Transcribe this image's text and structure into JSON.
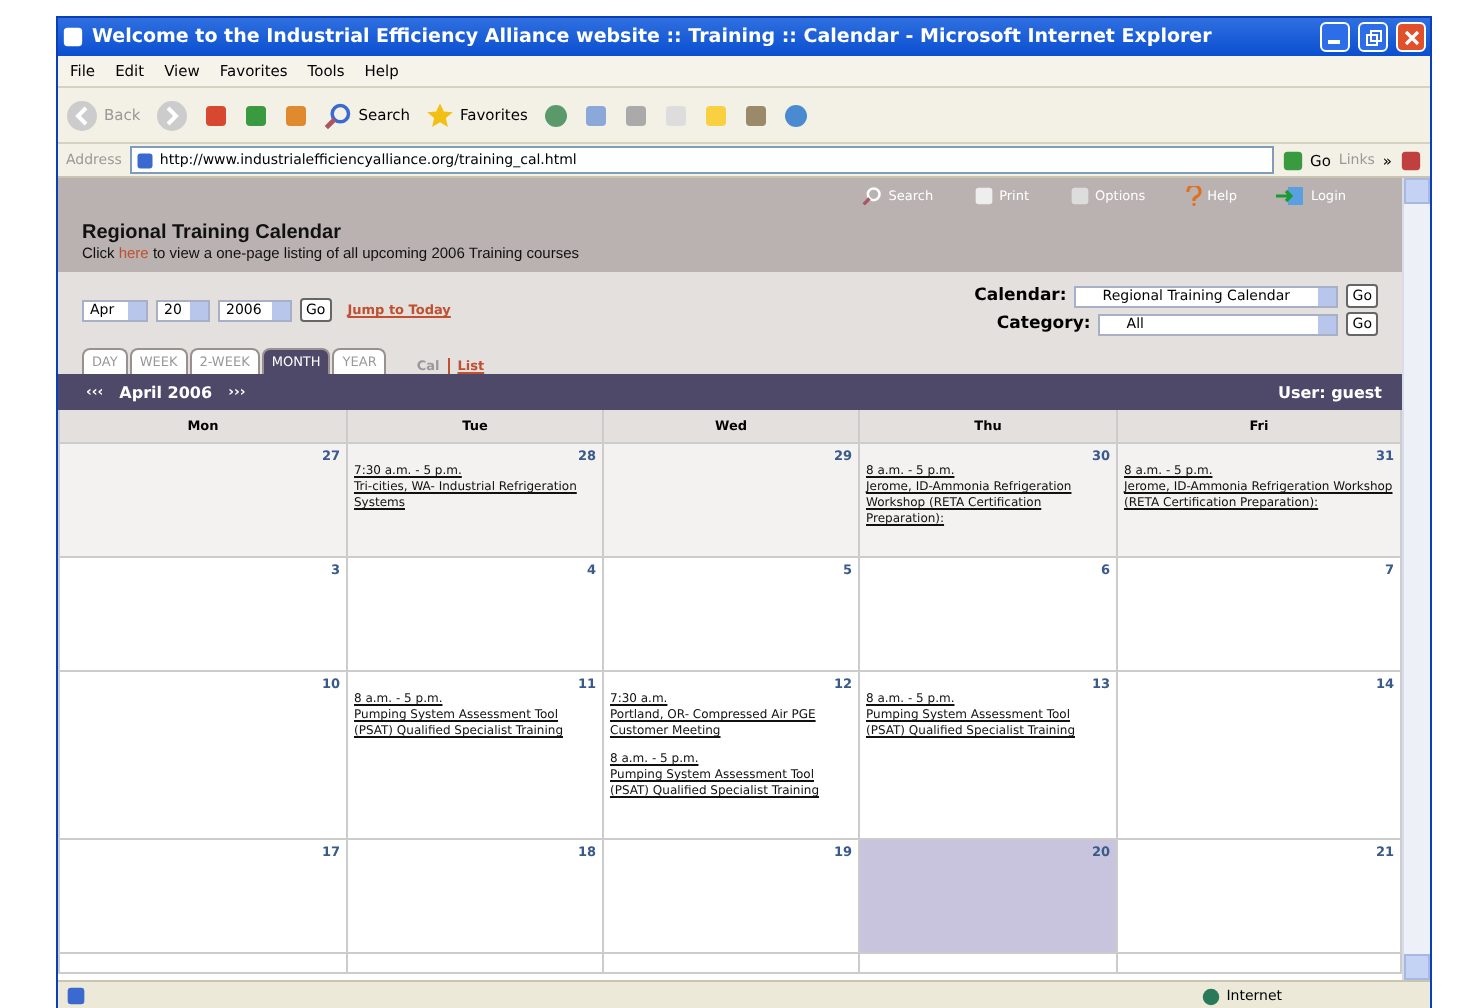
{
  "window": {
    "title": "Welcome to the Industrial Efficiency Alliance website :: Training :: Calendar - Microsoft Internet Explorer"
  },
  "menu": [
    "File",
    "Edit",
    "View",
    "Favorites",
    "Tools",
    "Help"
  ],
  "toolbar": {
    "back": "Back",
    "search": "Search",
    "favorites": "Favorites"
  },
  "address": {
    "label": "Address",
    "url": "http://www.industrialefficiencyalliance.org/training_cal.html",
    "go": "Go",
    "links": "Links",
    "more": "»"
  },
  "site_links": [
    {
      "kind": "search",
      "label": "Search"
    },
    {
      "kind": "print",
      "label": "Print"
    },
    {
      "kind": "options",
      "label": "Options"
    },
    {
      "kind": "help",
      "label": "Help"
    },
    {
      "kind": "login",
      "label": "Login"
    }
  ],
  "heading": {
    "title": "Regional Training Calendar",
    "before": "Click ",
    "link": "here",
    "after": " to view a one-page listing of all upcoming 2006 Training courses"
  },
  "date_picker": {
    "month": "Apr",
    "day": "20",
    "year": "2006",
    "go": "Go",
    "jump": "Jump to Today"
  },
  "filters": [
    {
      "label": "Calendar:",
      "value": "Regional Training Calendar",
      "go": "Go"
    },
    {
      "label": "Category:",
      "value": "All",
      "go": "Go"
    }
  ],
  "tabs": [
    {
      "label": "DAY",
      "selected": false
    },
    {
      "label": "WEEK",
      "selected": false
    },
    {
      "label": "2-WEEK",
      "selected": false
    },
    {
      "label": "MONTH",
      "selected": true
    },
    {
      "label": "YEAR",
      "selected": false
    }
  ],
  "views": [
    {
      "label": "Cal",
      "selected": false
    },
    {
      "label": "List",
      "selected": true
    }
  ],
  "month_bar": {
    "prev": "‹‹‹",
    "title": "April 2006",
    "next": "›››",
    "user": "User: guest"
  },
  "weekdays": [
    "Mon",
    "Tue",
    "Wed",
    "Thu",
    "Fri"
  ],
  "weeks": [
    [
      {
        "date": "27",
        "other_month": true,
        "today": false
      },
      {
        "date": "28",
        "other_month": true,
        "today": false,
        "events": [
          {
            "time": "7:30 a.m. - 5 p.m.",
            "title": "Tri-cities, WA- Industrial Refrigeration Systems"
          }
        ]
      },
      {
        "date": "29",
        "other_month": true,
        "today": false
      },
      {
        "date": "30",
        "other_month": true,
        "today": false,
        "events": [
          {
            "time": "8 a.m. - 5 p.m.",
            "title": "Jerome, ID-Ammonia Refrigeration Workshop (RETA Certification Preparation):"
          }
        ]
      },
      {
        "date": "31",
        "other_month": true,
        "today": false,
        "events": [
          {
            "time": "8 a.m. - 5 p.m.",
            "title": "Jerome, ID-Ammonia Refrigeration Workshop (RETA Certification Preparation):"
          }
        ]
      }
    ],
    [
      {
        "date": "3",
        "other_month": false,
        "today": false
      },
      {
        "date": "4",
        "other_month": false,
        "today": false
      },
      {
        "date": "5",
        "other_month": false,
        "today": false
      },
      {
        "date": "6",
        "other_month": false,
        "today": false
      },
      {
        "date": "7",
        "other_month": false,
        "today": false
      }
    ],
    [
      {
        "date": "10",
        "other_month": false,
        "today": false
      },
      {
        "date": "11",
        "other_month": false,
        "today": false,
        "events": [
          {
            "time": "8 a.m. - 5 p.m.",
            "title": "Pumping System Assessment Tool (PSAT) Qualified Specialist Training"
          }
        ]
      },
      {
        "date": "12",
        "other_month": false,
        "today": false,
        "events": [
          {
            "time": "7:30 a.m.",
            "title": "Portland, OR- Compressed Air PGE Customer Meeting"
          },
          {
            "time": "8 a.m. - 5 p.m.",
            "title": "Pumping System Assessment Tool (PSAT) Qualified Specialist Training"
          }
        ]
      },
      {
        "date": "13",
        "other_month": false,
        "today": false,
        "events": [
          {
            "time": "8 a.m. - 5 p.m.",
            "title": "Pumping System Assessment Tool (PSAT) Qualified Specialist Training"
          }
        ]
      },
      {
        "date": "14",
        "other_month": false,
        "today": false
      }
    ],
    [
      {
        "date": "17",
        "other_month": false,
        "today": false
      },
      {
        "date": "18",
        "other_month": false,
        "today": false
      },
      {
        "date": "19",
        "other_month": false,
        "today": false
      },
      {
        "date": "20",
        "other_month": false,
        "today": true
      },
      {
        "date": "21",
        "other_month": false,
        "today": false
      }
    ]
  ],
  "status_bar": {
    "zone": "Internet"
  }
}
